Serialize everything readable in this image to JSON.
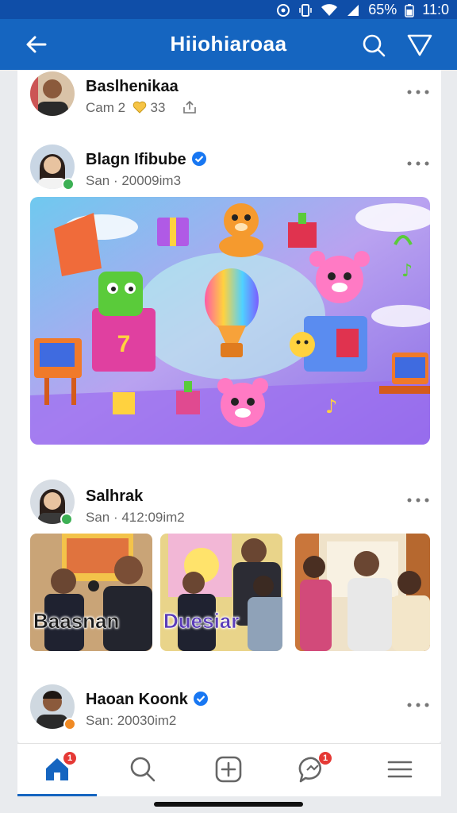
{
  "status_bar": {
    "battery": "65%",
    "time": "11:0"
  },
  "header": {
    "title": "Hiiohiaroaa"
  },
  "posts": [
    {
      "name": "Baslhenikaa",
      "meta": "Cam 2",
      "reactions": "33"
    },
    {
      "name": "Blagn Ifibube",
      "meta": "San · 20009im3"
    },
    {
      "name": "Salhrak",
      "meta": "San · 412:09im2",
      "photo_captions": [
        "Baasnan",
        "Duesiar"
      ]
    },
    {
      "name": "Haoan Koonk",
      "meta": "San: 20030im2"
    }
  ],
  "bottom_nav": {
    "items": [
      "home",
      "search",
      "create",
      "messages",
      "menu"
    ],
    "home_badge": "1",
    "messages_badge": "1"
  },
  "colors": {
    "brand": "#1565c0",
    "status_bar": "#0f4ea8",
    "verified": "#1877f2",
    "badge": "#e53935"
  }
}
